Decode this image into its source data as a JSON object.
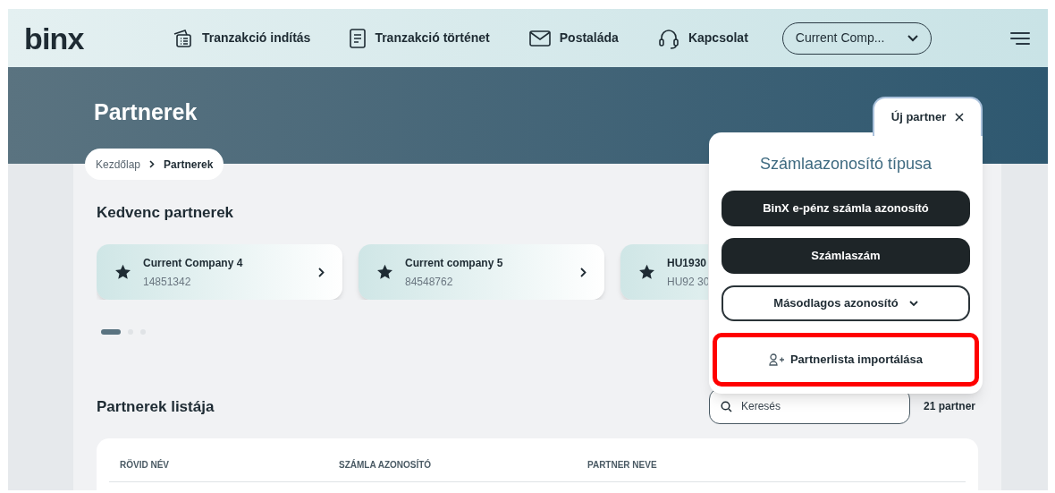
{
  "logo": "binx",
  "nav": [
    {
      "kind": "transfer",
      "label": "Tranzakció indítás"
    },
    {
      "kind": "history",
      "label": "Tranzakció történet"
    },
    {
      "kind": "mail",
      "label": "Postaláda"
    },
    {
      "kind": "headset",
      "label": "Kapcsolat"
    }
  ],
  "company_select": {
    "value": "Current Comp..."
  },
  "page_title": "Partnerek",
  "breadcrumb": [
    {
      "label": "Kezdőlap",
      "current": false
    },
    {
      "label": "Partnerek",
      "current": true
    }
  ],
  "favorites": {
    "title": "Kedvenc partnerek",
    "cards": [
      {
        "name": "Current Company 4",
        "id": "14851342",
        "arrow": true
      },
      {
        "name": "Current company 5",
        "id": "84548762",
        "arrow": true
      },
      {
        "name": "HU1930",
        "id": "HU92 30",
        "arrow": false
      }
    ],
    "pager": [
      {
        "selected": true
      },
      {
        "selected": false
      },
      {
        "selected": false
      }
    ]
  },
  "list": {
    "title": "Partnerek listája",
    "search": {
      "placeholder": "Keresés"
    },
    "count": "21 partner",
    "columns": [
      "RÖVID NÉV",
      "SZÁMLA AZONOSÍTÓ",
      "PARTNER NEVE"
    ]
  },
  "popup": {
    "tab": "Új partner",
    "title": "Számlaazonosító típusa",
    "options": [
      {
        "kind": "filled",
        "label": "BinX e-pénz számla azonosító",
        "highlighted": false
      },
      {
        "kind": "filled",
        "label": "Számlaszám",
        "highlighted": false
      },
      {
        "kind": "dropdown",
        "label": "Másodlagos azonosító",
        "highlighted": false
      },
      {
        "kind": "import",
        "label": "Partnerlista importálása",
        "highlighted": true
      }
    ]
  }
}
